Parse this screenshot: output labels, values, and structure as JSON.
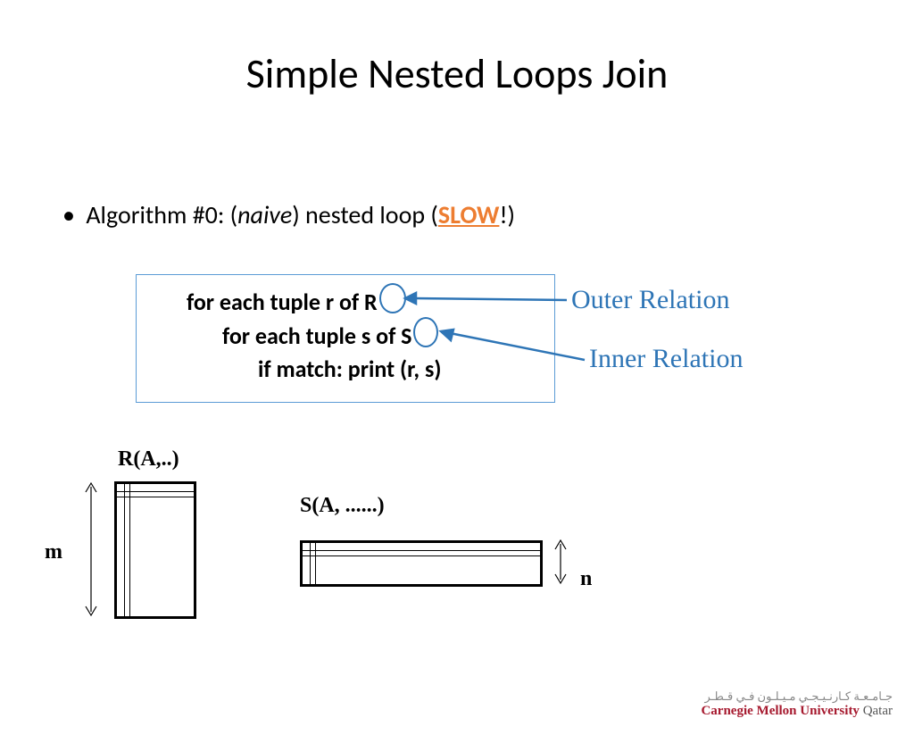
{
  "title": "Simple Nested Loops Join",
  "bullet": {
    "prefix": "Algorithm #0: (",
    "naive": "naive",
    "mid": ") nested loop (",
    "slow": "SLOW",
    "suffix": "!)"
  },
  "code": {
    "line1": "for each tuple r of R",
    "line2": "for each tuple s of S",
    "line3": "if match: print (r, s)"
  },
  "annotations": {
    "outer": "Outer Relation",
    "inner": "Inner Relation"
  },
  "labels": {
    "R": "R(A,..)",
    "S": "S(A, ......)",
    "m": "m",
    "n": "n"
  },
  "logo": {
    "arabic": "جـامـعـة كـارنـيـجـي مـيـلـون فـي قـطـر",
    "en_bold": "Carnegie Mellon University",
    "en_qatar": " Qatar"
  }
}
